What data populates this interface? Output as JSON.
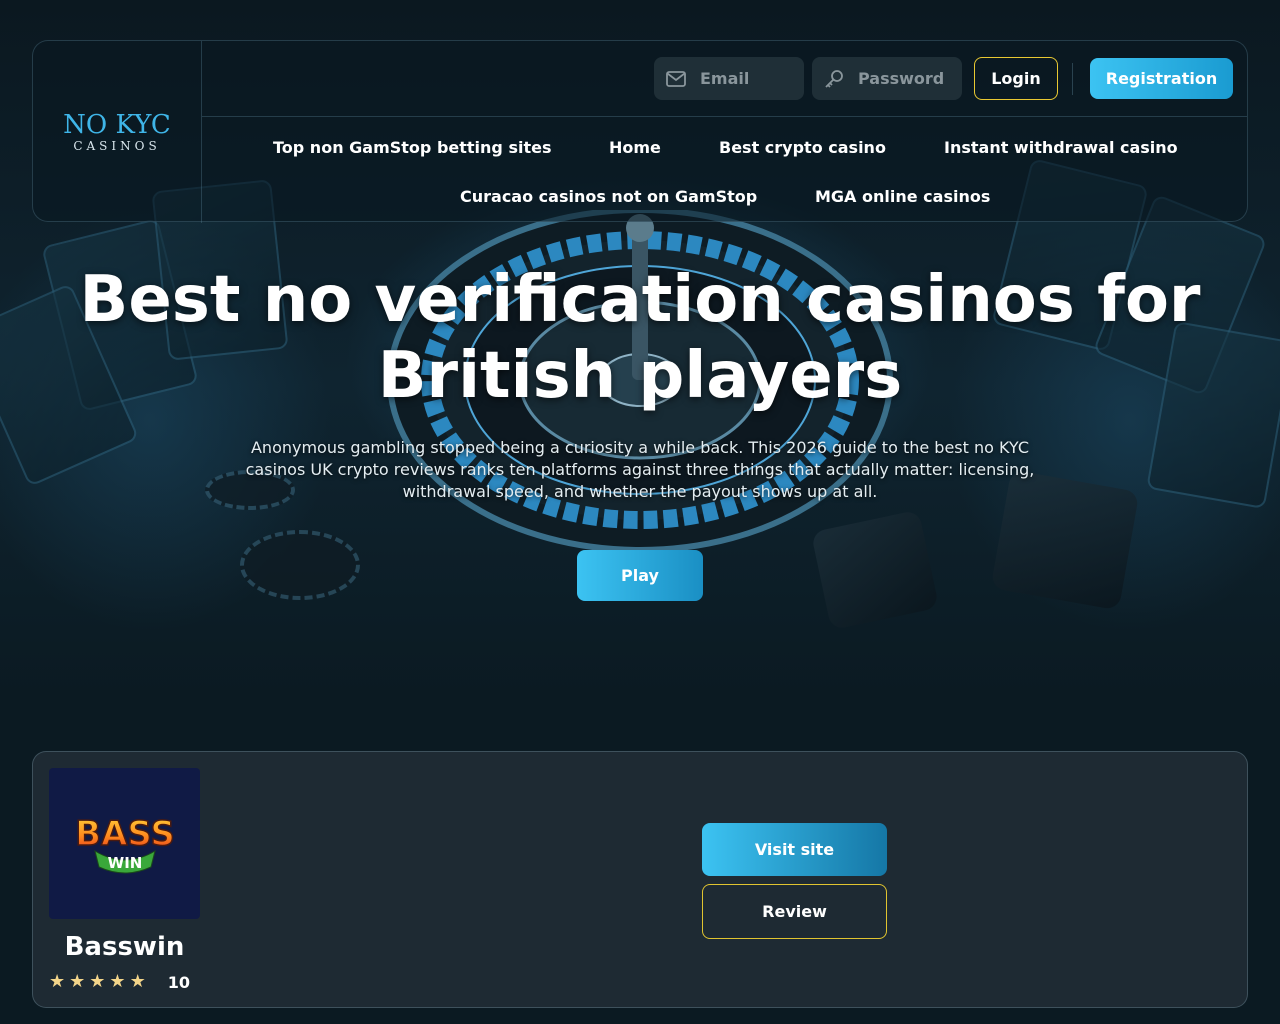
{
  "colors": {
    "background": "#0b1a22",
    "accent": "#3cc3f2",
    "gold_border": "#e8c832",
    "card_bg": "#1e2a33",
    "star": "#f3d58a"
  },
  "logo": {
    "main": "NO KYC",
    "sub": "CASINOS"
  },
  "auth": {
    "email_placeholder": "Email",
    "password_placeholder": "Password",
    "login_label": "Login",
    "registration_label": "Registration",
    "email_icon": "mail-icon",
    "password_icon": "key-icon"
  },
  "nav": {
    "items": [
      {
        "label": "Top non GamStop betting sites"
      },
      {
        "label": "Home"
      },
      {
        "label": "Best crypto casino"
      },
      {
        "label": "Instant withdrawal casino"
      },
      {
        "label": "Curacao casinos not on GamStop"
      },
      {
        "label": "MGA online casinos"
      }
    ]
  },
  "hero": {
    "title_line1": "Best no verification casinos for",
    "title_line2": "British players",
    "description": "Anonymous gambling stopped being a curiosity a while back. This 2026 guide to the best no KYC casinos UK crypto reviews ranks ten platforms against three things that actually matter: licensing, withdrawal speed, and whether the payout shows up at all.",
    "play_label": "Play"
  },
  "casino": {
    "logo_line1": "BASS",
    "logo_line2": "WIN",
    "name": "Basswin",
    "stars": 5,
    "rating": "10",
    "visit_label": "Visit site",
    "review_label": "Review"
  }
}
